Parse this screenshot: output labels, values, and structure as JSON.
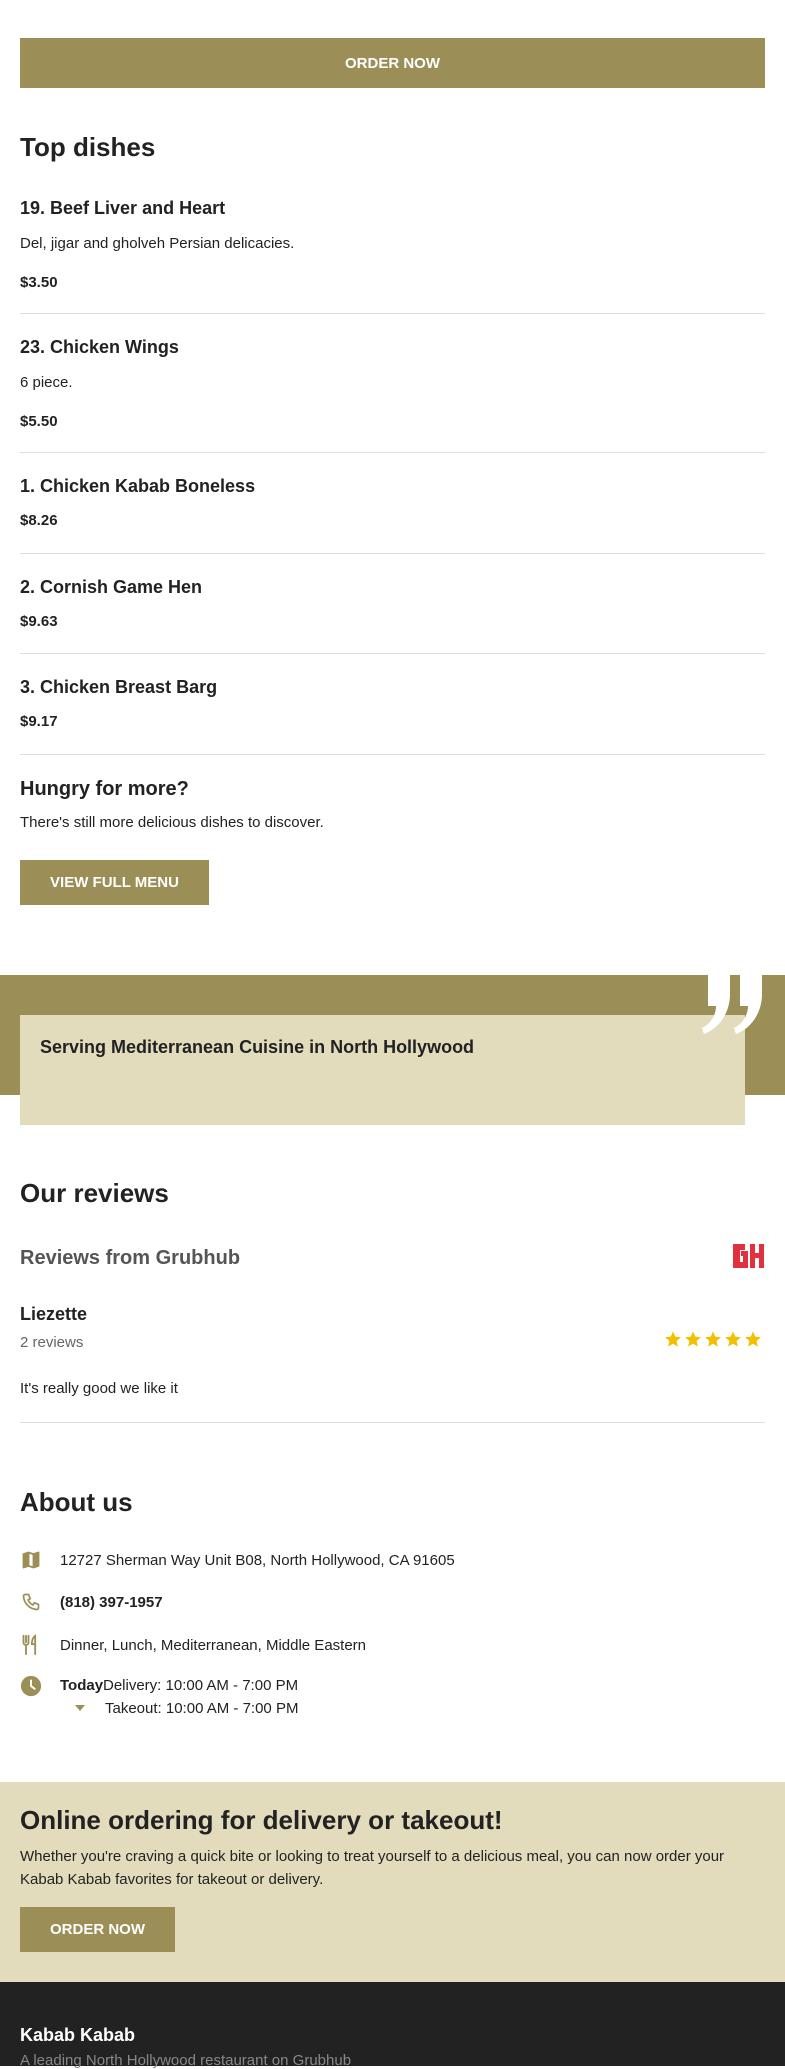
{
  "colors": {
    "accent": "#9c8e57",
    "accent_light": "#e2dcbd",
    "footer_bg": "#222222",
    "star": "#f2c000",
    "grubhub_red": "#e3303f"
  },
  "top_order_button": "ORDER NOW",
  "top_dishes": {
    "heading": "Top dishes",
    "items": [
      {
        "name": "19. Beef Liver and Heart",
        "description": "Del, jigar and gholveh Persian delicacies.",
        "price": "$3.50"
      },
      {
        "name": "23. Chicken Wings",
        "description": "6 piece.",
        "price": "$5.50"
      },
      {
        "name": "1. Chicken Kabab Boneless",
        "price": "$8.26"
      },
      {
        "name": "2. Cornish Game Hen",
        "price": "$9.63"
      },
      {
        "name": "3. Chicken Breast Barg",
        "price": "$9.17"
      }
    ]
  },
  "hungry": {
    "title": "Hungry for more?",
    "text": "There's still more delicious dishes to discover.",
    "button": "VIEW FULL MENU"
  },
  "banner": {
    "text": "Serving Mediterranean Cuisine in North Hollywood",
    "icon": "quote-icon"
  },
  "reviews": {
    "heading": "Our reviews",
    "source": "Reviews from Grubhub",
    "logo_letters": "GH",
    "items": [
      {
        "author": "Liezette",
        "count": "2 reviews",
        "rating": 5,
        "text": "It's really good we like it"
      }
    ]
  },
  "about": {
    "heading": "About us",
    "address": "12727 Sherman Way Unit B08, North Hollywood, CA 91605",
    "phone": "(818) 397-1957",
    "cuisines": "Dinner, Lunch, Mediterranean, Middle Eastern",
    "hours": {
      "today_label": "Today",
      "delivery": "Delivery: 10:00 AM - 7:00 PM",
      "takeout": "Takeout: 10:00 AM - 7:00 PM"
    },
    "icons": [
      "map-icon",
      "phone-icon",
      "utensils-icon",
      "clock-icon",
      "caret-down-icon"
    ]
  },
  "promo": {
    "title": "Online ordering for delivery or takeout!",
    "text": "Whether you're craving a quick bite or looking to treat yourself to a delicious meal, you can now order your Kabab Kabab favorites for takeout or delivery.",
    "button": "ORDER NOW"
  },
  "footer": {
    "title": "Kabab Kabab",
    "subtitle": "A leading North Hollywood restaurant on Grubhub"
  }
}
